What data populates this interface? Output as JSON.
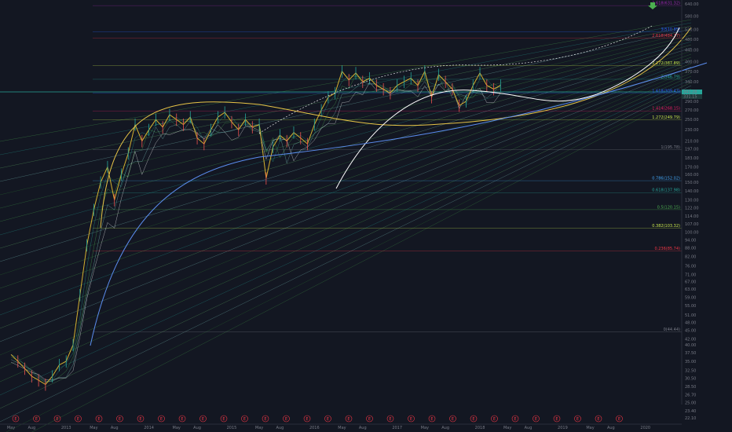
{
  "chart_data": {
    "type": "line",
    "y_scale": "log",
    "background": "#131722",
    "price_axis_ticks": [
      "640.00",
      "580.00",
      "520.00",
      "480.00",
      "440.00",
      "400.00",
      "370.00",
      "340.00",
      "310.00",
      "290.00",
      "270.00",
      "250.00",
      "230.00",
      "210.00",
      "197.00",
      "183.00",
      "170.00",
      "160.00",
      "150.00",
      "140.00",
      "130.00",
      "122.00",
      "114.00",
      "107.00",
      "100.00",
      "94.00",
      "88.00",
      "82.00",
      "76.00",
      "71.00",
      "67.00",
      "63.00",
      "59.00",
      "55.00",
      "51.00",
      "48.00",
      "45.00",
      "42.00",
      "40.00",
      "37.50",
      "35.00",
      "32.50",
      "30.50",
      "28.50",
      "26.70",
      "25.00",
      "23.40",
      "22.10"
    ],
    "time_axis_ticks": [
      "May",
      "Aug",
      "2013",
      "May",
      "Aug",
      "2014",
      "May",
      "Aug",
      "2015",
      "May",
      "Aug",
      "2016",
      "May",
      "Aug",
      "2017",
      "May",
      "Aug",
      "2018",
      "May",
      "Aug",
      "2019",
      "May",
      "Aug",
      "2020"
    ],
    "current_price_labels": [
      "341.28",
      "331.15"
    ],
    "fib_levels": [
      {
        "label": "3.618(631.32)",
        "value": 631.32,
        "color": "#9c27b0"
      },
      {
        "label": "3(510.85)",
        "value": 510.85,
        "color": "#2962ff"
      },
      {
        "label": "2.618(484.17)",
        "value": 484.17,
        "color": "#f23645"
      },
      {
        "label": "2.272(387.89)",
        "value": 387.89,
        "color": "#c8e64c"
      },
      {
        "label": "2(346.79)",
        "value": 346.79,
        "color": "#26a69a"
      },
      {
        "label": "1.618(309.43)",
        "value": 309.43,
        "color": "#2962ff"
      },
      {
        "label": "1.414(268.15)",
        "value": 268.15,
        "color": "#e91e63"
      },
      {
        "label": "1.272(249.79)",
        "value": 249.79,
        "color": "#c8e64c"
      },
      {
        "label": "1(195.78)",
        "value": 195.78,
        "color": "#787b86"
      },
      {
        "label": "0.786(152.02)",
        "value": 152.02,
        "color": "#42a5f5"
      },
      {
        "label": "0.618(137.98)",
        "value": 137.98,
        "color": "#26a69a"
      },
      {
        "label": "0.5(120.15)",
        "value": 120.15,
        "color": "#4caf50"
      },
      {
        "label": "0.382(103.32)",
        "value": 103.32,
        "color": "#c8e64c"
      },
      {
        "label": "0.236(85.74)",
        "value": 85.74,
        "color": "#f23645"
      },
      {
        "label": "0(44.44)",
        "value": 44.44,
        "color": "#787b86"
      }
    ],
    "earnings_marker_label": "E",
    "earnings_marker_count": 30,
    "series_colors": {
      "price": "#d4b030",
      "up": "#26a69a",
      "down": "#ef5350",
      "arc_yellow": "#e8c547",
      "arc_white": "#ffffff",
      "trend_blue": "#5b8def"
    }
  }
}
